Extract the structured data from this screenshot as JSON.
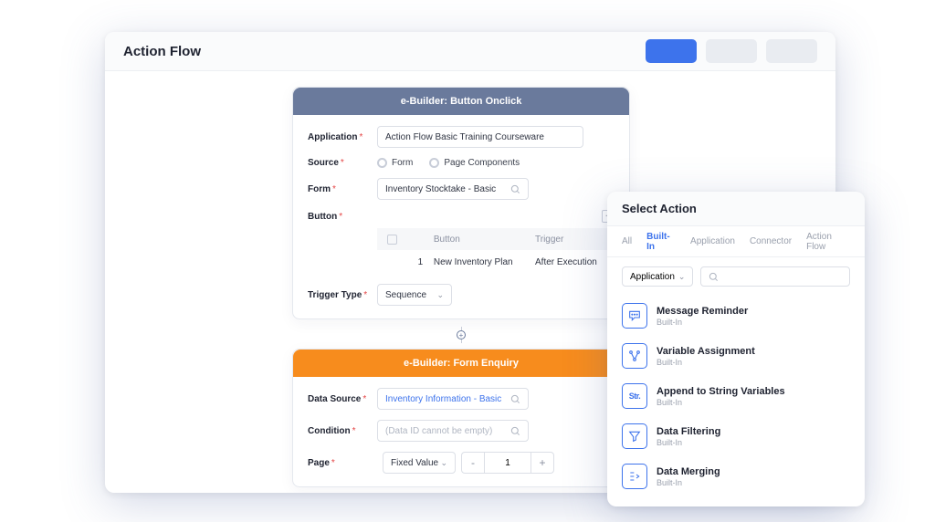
{
  "header": {
    "title": "Action Flow"
  },
  "card1": {
    "title": "e-Builder: Button Onclick",
    "labels": {
      "application": "Application",
      "source": "Source",
      "form": "Form",
      "button": "Button",
      "trigger_type": "Trigger Type"
    },
    "application_value": "Action Flow Basic Training Courseware",
    "source_options": {
      "form": "Form",
      "page_components": "Page Components"
    },
    "form_value": "Inventory Stocktake - Basic",
    "button_table": {
      "columns": {
        "button": "Button",
        "trigger": "Trigger"
      },
      "row": {
        "index": "1",
        "button": "New Inventory Plan",
        "trigger": "After Execution"
      }
    },
    "trigger_type_value": "Sequence"
  },
  "card2": {
    "title": "e-Builder: Form Enquiry",
    "labels": {
      "data_source": "Data Source",
      "condition": "Condition",
      "page": "Page"
    },
    "data_source_value": "Inventory Information - Basic",
    "condition_placeholder": "(Data ID cannot be empty)",
    "page_mode": "Fixed Value",
    "page_value": "1"
  },
  "panel": {
    "title": "Select Action",
    "tabs": {
      "all": "All",
      "builtin": "Built-In",
      "application": "Application",
      "connector": "Connector",
      "actionflow": "Action Flow"
    },
    "filter_select": "Application",
    "actions": [
      {
        "name": "Message Reminder",
        "sub": "Built-In"
      },
      {
        "name": "Variable Assignment",
        "sub": "Built-In"
      },
      {
        "name": "Append to String Variables",
        "sub": "Built-In"
      },
      {
        "name": "Data Filtering",
        "sub": "Built-In"
      },
      {
        "name": "Data Merging",
        "sub": "Built-In"
      }
    ]
  }
}
